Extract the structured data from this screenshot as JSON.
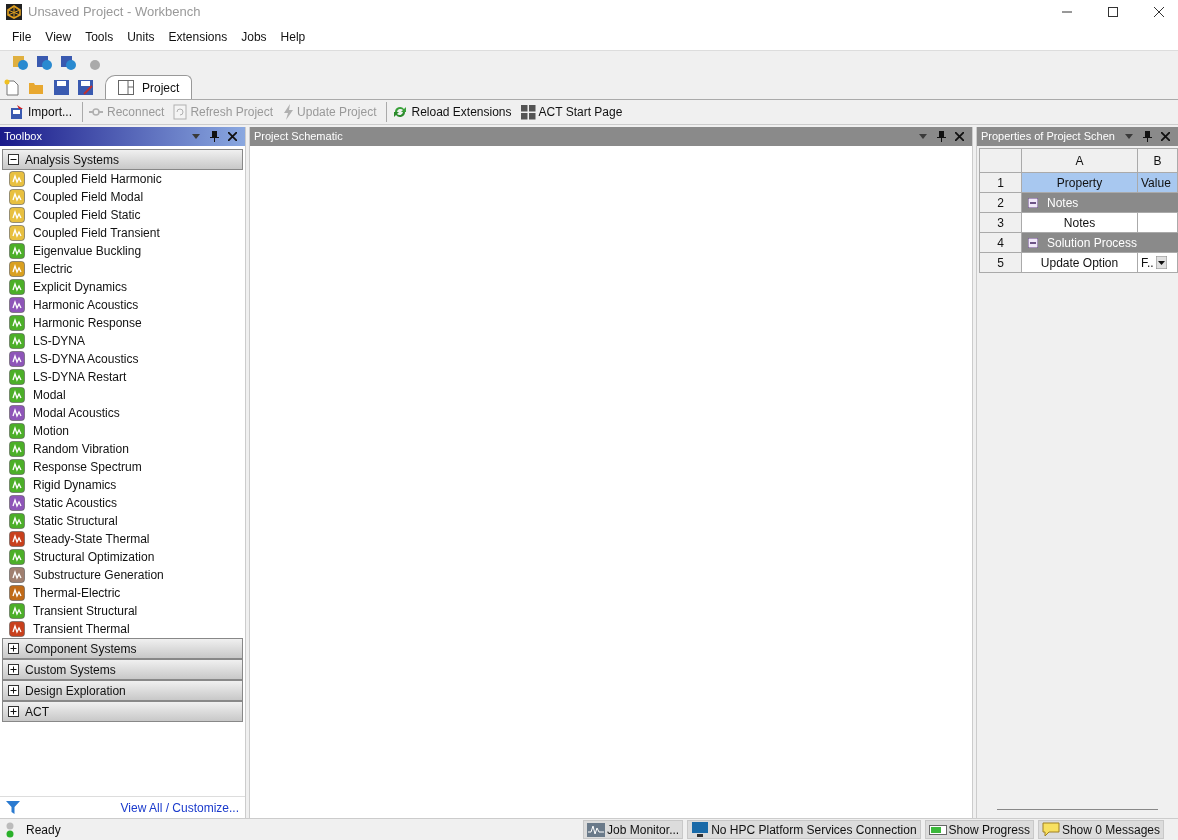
{
  "window": {
    "title": "Unsaved Project - Workbench"
  },
  "menu": [
    "File",
    "View",
    "Tools",
    "Units",
    "Extensions",
    "Jobs",
    "Help"
  ],
  "project_tab": {
    "label": "Project",
    "selected": true
  },
  "toolbar": [
    {
      "label": "Import...",
      "disabled": false,
      "kind": "import"
    },
    {
      "label": "Reconnect",
      "disabled": true,
      "kind": "reconnect"
    },
    {
      "label": "Refresh Project",
      "disabled": true,
      "kind": "refresh"
    },
    {
      "label": "Update Project",
      "disabled": true,
      "kind": "update"
    },
    {
      "label": "Reload Extensions",
      "disabled": false,
      "kind": "reload"
    },
    {
      "label": "ACT Start Page",
      "disabled": false,
      "kind": "act"
    }
  ],
  "toolbox": {
    "title": "Toolbox",
    "groups": [
      {
        "label": "Analysis Systems",
        "expanded": true,
        "items": [
          {
            "label": "Coupled Field Harmonic",
            "color": "#e8c040"
          },
          {
            "label": "Coupled Field Modal",
            "color": "#e8c040"
          },
          {
            "label": "Coupled Field Static",
            "color": "#e8c040"
          },
          {
            "label": "Coupled Field Transient",
            "color": "#e8c040"
          },
          {
            "label": "Eigenvalue Buckling",
            "color": "#4caf28"
          },
          {
            "label": "Electric",
            "color": "#d9a020"
          },
          {
            "label": "Explicit Dynamics",
            "color": "#4caf28"
          },
          {
            "label": "Harmonic Acoustics",
            "color": "#8e55b8"
          },
          {
            "label": "Harmonic Response",
            "color": "#4caf28"
          },
          {
            "label": "LS-DYNA",
            "color": "#4caf28"
          },
          {
            "label": "LS-DYNA Acoustics",
            "color": "#8e55b8"
          },
          {
            "label": "LS-DYNA Restart",
            "color": "#4caf28"
          },
          {
            "label": "Modal",
            "color": "#4caf28"
          },
          {
            "label": "Modal Acoustics",
            "color": "#8e55b8"
          },
          {
            "label": "Motion",
            "color": "#4caf28"
          },
          {
            "label": "Random Vibration",
            "color": "#4caf28"
          },
          {
            "label": "Response Spectrum",
            "color": "#4caf28"
          },
          {
            "label": "Rigid Dynamics",
            "color": "#4caf28"
          },
          {
            "label": "Static Acoustics",
            "color": "#8e55b8"
          },
          {
            "label": "Static Structural",
            "color": "#4caf28"
          },
          {
            "label": "Steady-State Thermal",
            "color": "#c8401c"
          },
          {
            "label": "Structural Optimization",
            "color": "#4caf28"
          },
          {
            "label": "Substructure Generation",
            "color": "#a08070"
          },
          {
            "label": "Thermal-Electric",
            "color": "#c06a18"
          },
          {
            "label": "Transient Structural",
            "color": "#4caf28"
          },
          {
            "label": "Transient Thermal",
            "color": "#c8401c"
          }
        ]
      },
      {
        "label": "Component Systems",
        "expanded": false
      },
      {
        "label": "Custom Systems",
        "expanded": false
      },
      {
        "label": "Design Exploration",
        "expanded": false
      },
      {
        "label": "ACT",
        "expanded": false
      }
    ],
    "footer_link": "View All / Customize..."
  },
  "schematic": {
    "title": "Project Schematic"
  },
  "properties": {
    "title": "Properties of Project Schen",
    "columns": [
      "A",
      "B"
    ],
    "rows": [
      {
        "number": "1",
        "kind": "header",
        "property": "Property",
        "value": "Value"
      },
      {
        "number": "2",
        "kind": "group",
        "property": "Notes",
        "expanded": true
      },
      {
        "number": "3",
        "kind": "property",
        "property": "Notes"
      },
      {
        "number": "4",
        "kind": "group",
        "property": "Solution Process",
        "expanded": true
      },
      {
        "number": "5",
        "kind": "dropdown",
        "property": "Update Option",
        "value": "F.."
      }
    ]
  },
  "status_bar": {
    "text": "Ready",
    "buttons": [
      {
        "label": "Job Monitor...",
        "kind": "monitor"
      },
      {
        "label": "No HPC Platform Services Connection",
        "kind": "hpc"
      },
      {
        "label": "Show Progress",
        "kind": "progress"
      },
      {
        "label": "Show 0 Messages",
        "kind": "messages"
      }
    ]
  }
}
